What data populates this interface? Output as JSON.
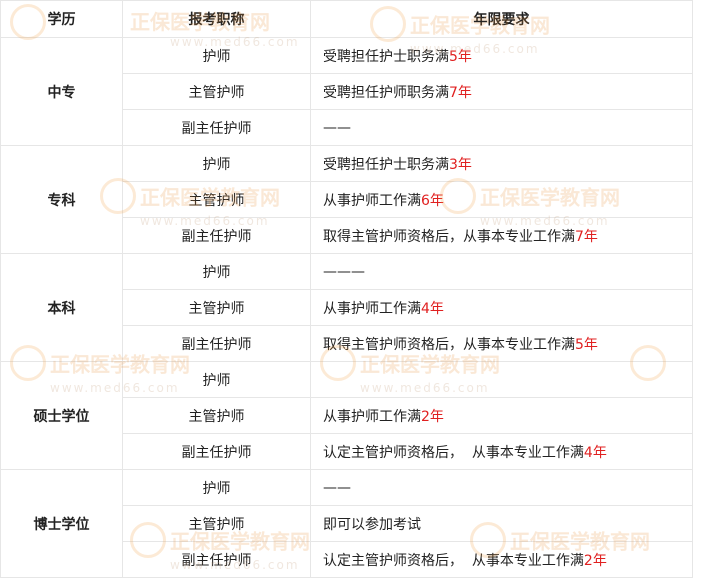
{
  "header": {
    "col1": "学历",
    "col2": "报考职称",
    "col3": "年限要求"
  },
  "groups": [
    {
      "edu": "中专",
      "rows": [
        {
          "title": "护师",
          "req": "受聘担任护士职务满",
          "years": "5年"
        },
        {
          "title": "主管护师",
          "req": "受聘担任护师职务满",
          "years": "7年"
        },
        {
          "title": "副主任护师",
          "req": "——",
          "years": ""
        }
      ]
    },
    {
      "edu": "专科",
      "rows": [
        {
          "title": "护师",
          "req": "受聘担任护士职务满",
          "years": "3年"
        },
        {
          "title": "主管护师",
          "req": "从事护师工作满",
          "years": "6年"
        },
        {
          "title": "副主任护师",
          "req": "取得主管护师资格后，从事本专业工作满",
          "years": "7年"
        }
      ]
    },
    {
      "edu": "本科",
      "rows": [
        {
          "title": "护师",
          "req": "———",
          "years": ""
        },
        {
          "title": "主管护师",
          "req": "从事护师工作满",
          "years": "4年"
        },
        {
          "title": "副主任护师",
          "req": "取得主管护师资格后，从事本专业工作满",
          "years": "5年"
        }
      ]
    },
    {
      "edu": "硕士学位",
      "rows": [
        {
          "title": "护师",
          "req": "",
          "years": ""
        },
        {
          "title": "主管护师",
          "req": "从事护师工作满",
          "years": "2年"
        },
        {
          "title": "副主任护师",
          "req": "认定主管护师资格后，  从事本专业工作满",
          "years": "4年"
        }
      ]
    },
    {
      "edu": "博士学位",
      "rows": [
        {
          "title": "护师",
          "req": "——",
          "years": ""
        },
        {
          "title": "主管护师",
          "req": "即可以参加考试",
          "years": ""
        },
        {
          "title": "副主任护师",
          "req": "认定主管护师资格后，  从事本专业工作满",
          "years": "2年"
        }
      ]
    }
  ],
  "watermark": {
    "brand": "正保医学教育网",
    "url": "www.med66.com"
  }
}
